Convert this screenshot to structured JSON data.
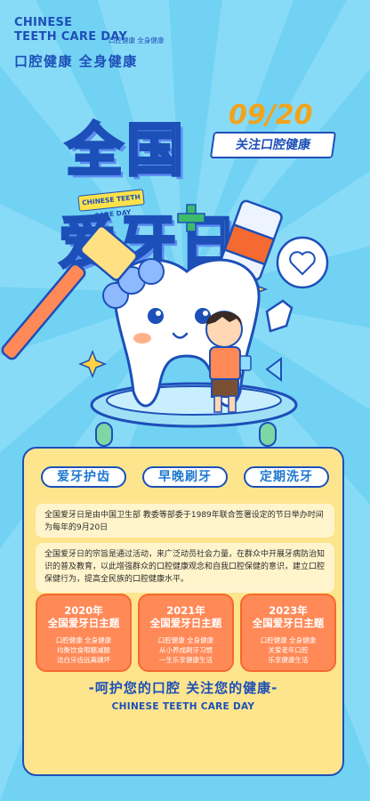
{
  "header": {
    "en_line1": "CHINESE",
    "en_line2": "TEETH CARE DAY",
    "small_tag": "口腔健康 全身健康",
    "slogan": "口腔健康  全身健康"
  },
  "hero": {
    "date": "09/20",
    "subtitle": "关注口腔健康",
    "title_line1": "全国",
    "title_line2": "爱牙日",
    "mini_banner": "CHINESE TEETH CARE DAY"
  },
  "tags": [
    "爱牙护齿",
    "早晚刷牙",
    "定期洗牙"
  ],
  "paragraphs": [
    "全国爱牙日是由中国卫生部 教委等部委于1989年联合签署设定的节日举办时间为每年的9月20日",
    "全国爱牙日的宗旨是通过活动，来广泛动员社会力量，在群众中开展牙病防治知识的普及教育，以此增强群众的口腔健康观念和自我口腔保健的意识，建立口腔保健行为，提高全民族的口腔健康水平。"
  ],
  "years": [
    {
      "year": "2020年",
      "title": "全国爱牙日主题",
      "lines": [
        "口腔健康 全身健康",
        "均衡饮食限糖减酸",
        "洁白牙齿远离龋坏"
      ]
    },
    {
      "year": "2021年",
      "title": "全国爱牙日主题",
      "lines": [
        "口腔健康 全身健康",
        "从小养成刷牙习惯",
        "一生乐享健康生活"
      ]
    },
    {
      "year": "2023年",
      "title": "全国爱牙日主题",
      "lines": [
        "口腔健康 全身健康",
        "关爱老年口腔",
        "乐享健康生活"
      ]
    }
  ],
  "footer": {
    "cn": "-呵护您的口腔 关注您的健康-",
    "en": "CHINESE TEETH CARE DAY"
  },
  "colors": {
    "background": "#72d2f4",
    "brand_blue": "#1d4fb8",
    "accent_yellow": "#fde58d",
    "accent_orange": "#ff8a58"
  }
}
